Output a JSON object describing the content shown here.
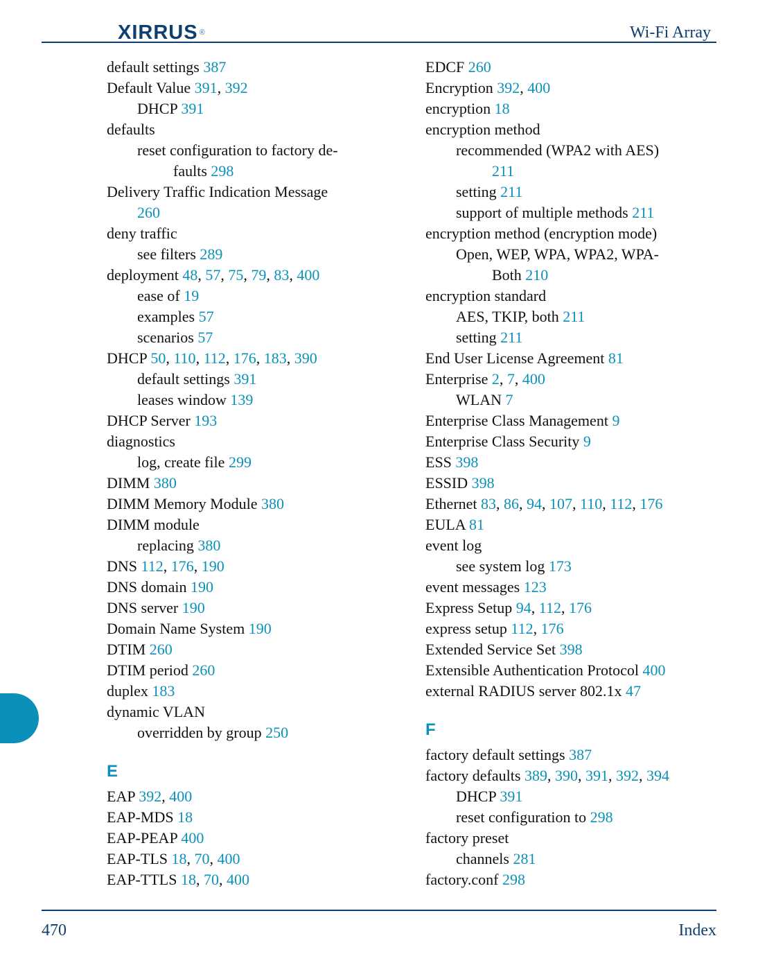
{
  "header": {
    "brand": "XIRRUS",
    "brand_reg": "®",
    "doc_title": "Wi-Fi Array"
  },
  "footer": {
    "page_number": "470",
    "label": "Index"
  },
  "columns": {
    "left": [
      {
        "type": "entry",
        "indent": 0,
        "parts": [
          {
            "t": "default settings "
          },
          {
            "p": "387"
          }
        ]
      },
      {
        "type": "entry",
        "indent": 0,
        "parts": [
          {
            "t": "Default Value "
          },
          {
            "p": "391"
          },
          {
            "t": ", "
          },
          {
            "p": "392"
          }
        ]
      },
      {
        "type": "entry",
        "indent": 1,
        "parts": [
          {
            "t": "DHCP "
          },
          {
            "p": "391"
          }
        ]
      },
      {
        "type": "entry",
        "indent": 0,
        "parts": [
          {
            "t": "defaults"
          }
        ]
      },
      {
        "type": "entry",
        "indent": 1,
        "justify": true,
        "parts": [
          {
            "t": "reset configuration to factory de-"
          }
        ]
      },
      {
        "type": "entry",
        "indent": 2,
        "parts": [
          {
            "t": "faults "
          },
          {
            "p": "298"
          }
        ]
      },
      {
        "type": "entry",
        "indent": 0,
        "justify": true,
        "parts": [
          {
            "t": "Delivery Traffic Indication Message"
          }
        ]
      },
      {
        "type": "entry",
        "indent": 1,
        "parts": [
          {
            "p": "260"
          }
        ]
      },
      {
        "type": "entry",
        "indent": 0,
        "parts": [
          {
            "t": "deny traffic"
          }
        ]
      },
      {
        "type": "entry",
        "indent": 1,
        "parts": [
          {
            "t": "see filters "
          },
          {
            "p": "289"
          }
        ]
      },
      {
        "type": "entry",
        "indent": 0,
        "parts": [
          {
            "t": "deployment "
          },
          {
            "p": "48"
          },
          {
            "t": ", "
          },
          {
            "p": "57"
          },
          {
            "t": ", "
          },
          {
            "p": "75"
          },
          {
            "t": ", "
          },
          {
            "p": "79"
          },
          {
            "t": ", "
          },
          {
            "p": "83"
          },
          {
            "t": ", "
          },
          {
            "p": "400"
          }
        ]
      },
      {
        "type": "entry",
        "indent": 1,
        "parts": [
          {
            "t": "ease of "
          },
          {
            "p": "19"
          }
        ]
      },
      {
        "type": "entry",
        "indent": 1,
        "parts": [
          {
            "t": "examples "
          },
          {
            "p": "57"
          }
        ]
      },
      {
        "type": "entry",
        "indent": 1,
        "parts": [
          {
            "t": "scenarios "
          },
          {
            "p": "57"
          }
        ]
      },
      {
        "type": "entry",
        "indent": 0,
        "parts": [
          {
            "t": "DHCP "
          },
          {
            "p": "50"
          },
          {
            "t": ", "
          },
          {
            "p": "110"
          },
          {
            "t": ", "
          },
          {
            "p": "112"
          },
          {
            "t": ", "
          },
          {
            "p": "176"
          },
          {
            "t": ", "
          },
          {
            "p": "183"
          },
          {
            "t": ", "
          },
          {
            "p": "390"
          }
        ]
      },
      {
        "type": "entry",
        "indent": 1,
        "parts": [
          {
            "t": "default settings "
          },
          {
            "p": "391"
          }
        ]
      },
      {
        "type": "entry",
        "indent": 1,
        "parts": [
          {
            "t": "leases window "
          },
          {
            "p": "139"
          }
        ]
      },
      {
        "type": "entry",
        "indent": 0,
        "parts": [
          {
            "t": "DHCP Server "
          },
          {
            "p": "193"
          }
        ]
      },
      {
        "type": "entry",
        "indent": 0,
        "parts": [
          {
            "t": "diagnostics"
          }
        ]
      },
      {
        "type": "entry",
        "indent": 1,
        "parts": [
          {
            "t": "log, create file "
          },
          {
            "p": "299"
          }
        ]
      },
      {
        "type": "entry",
        "indent": 0,
        "parts": [
          {
            "t": "DIMM "
          },
          {
            "p": "380"
          }
        ]
      },
      {
        "type": "entry",
        "indent": 0,
        "parts": [
          {
            "t": "DIMM Memory Module "
          },
          {
            "p": "380"
          }
        ]
      },
      {
        "type": "entry",
        "indent": 0,
        "parts": [
          {
            "t": "DIMM module"
          }
        ]
      },
      {
        "type": "entry",
        "indent": 1,
        "parts": [
          {
            "t": "replacing "
          },
          {
            "p": "380"
          }
        ]
      },
      {
        "type": "entry",
        "indent": 0,
        "parts": [
          {
            "t": "DNS "
          },
          {
            "p": "112"
          },
          {
            "t": ", "
          },
          {
            "p": "176"
          },
          {
            "t": ", "
          },
          {
            "p": "190"
          }
        ]
      },
      {
        "type": "entry",
        "indent": 0,
        "parts": [
          {
            "t": "DNS domain "
          },
          {
            "p": "190"
          }
        ]
      },
      {
        "type": "entry",
        "indent": 0,
        "parts": [
          {
            "t": "DNS server "
          },
          {
            "p": "190"
          }
        ]
      },
      {
        "type": "entry",
        "indent": 0,
        "parts": [
          {
            "t": "Domain Name System "
          },
          {
            "p": "190"
          }
        ]
      },
      {
        "type": "entry",
        "indent": 0,
        "parts": [
          {
            "t": "DTIM "
          },
          {
            "p": "260"
          }
        ]
      },
      {
        "type": "entry",
        "indent": 0,
        "parts": [
          {
            "t": "DTIM period "
          },
          {
            "p": "260"
          }
        ]
      },
      {
        "type": "entry",
        "indent": 0,
        "parts": [
          {
            "t": "duplex "
          },
          {
            "p": "183"
          }
        ]
      },
      {
        "type": "entry",
        "indent": 0,
        "parts": [
          {
            "t": "dynamic VLAN"
          }
        ]
      },
      {
        "type": "entry",
        "indent": 1,
        "parts": [
          {
            "t": "overridden by group "
          },
          {
            "p": "250"
          }
        ]
      },
      {
        "type": "section",
        "letter": "E"
      },
      {
        "type": "entry",
        "indent": 0,
        "parts": [
          {
            "t": "EAP "
          },
          {
            "p": "392"
          },
          {
            "t": ", "
          },
          {
            "p": "400"
          }
        ]
      },
      {
        "type": "entry",
        "indent": 0,
        "parts": [
          {
            "t": "EAP-MDS "
          },
          {
            "p": "18"
          }
        ]
      },
      {
        "type": "entry",
        "indent": 0,
        "parts": [
          {
            "t": "EAP-PEAP "
          },
          {
            "p": "400"
          }
        ]
      },
      {
        "type": "entry",
        "indent": 0,
        "parts": [
          {
            "t": "EAP-TLS "
          },
          {
            "p": "18"
          },
          {
            "t": ", "
          },
          {
            "p": "70"
          },
          {
            "t": ", "
          },
          {
            "p": "400"
          }
        ]
      },
      {
        "type": "entry",
        "indent": 0,
        "parts": [
          {
            "t": "EAP-TTLS "
          },
          {
            "p": "18"
          },
          {
            "t": ", "
          },
          {
            "p": "70"
          },
          {
            "t": ", "
          },
          {
            "p": "400"
          }
        ]
      }
    ],
    "right": [
      {
        "type": "entry",
        "indent": 0,
        "parts": [
          {
            "t": "EDCF "
          },
          {
            "p": "260"
          }
        ]
      },
      {
        "type": "entry",
        "indent": 0,
        "parts": [
          {
            "t": "Encryption "
          },
          {
            "p": "392"
          },
          {
            "t": ", "
          },
          {
            "p": "400"
          }
        ]
      },
      {
        "type": "entry",
        "indent": 0,
        "parts": [
          {
            "t": "encryption "
          },
          {
            "p": "18"
          }
        ]
      },
      {
        "type": "entry",
        "indent": 0,
        "parts": [
          {
            "t": "encryption method"
          }
        ]
      },
      {
        "type": "entry",
        "indent": 1,
        "justify": true,
        "parts": [
          {
            "t": "recommended (WPA2 with AES)"
          }
        ]
      },
      {
        "type": "entry",
        "indent": 2,
        "parts": [
          {
            "p": "211"
          }
        ]
      },
      {
        "type": "entry",
        "indent": 1,
        "parts": [
          {
            "t": "setting "
          },
          {
            "p": "211"
          }
        ]
      },
      {
        "type": "entry",
        "indent": 1,
        "parts": [
          {
            "t": "support of multiple methods "
          },
          {
            "p": "211"
          }
        ]
      },
      {
        "type": "entry",
        "indent": 0,
        "parts": [
          {
            "t": "encryption method (encryption mode)"
          }
        ]
      },
      {
        "type": "entry",
        "indent": 1,
        "justify": true,
        "parts": [
          {
            "t": "Open, WEP, WPA, WPA2, WPA-"
          }
        ]
      },
      {
        "type": "entry",
        "indent": 2,
        "parts": [
          {
            "t": "Both "
          },
          {
            "p": "210"
          }
        ]
      },
      {
        "type": "entry",
        "indent": 0,
        "parts": [
          {
            "t": "encryption standard"
          }
        ]
      },
      {
        "type": "entry",
        "indent": 1,
        "parts": [
          {
            "t": "AES, TKIP, both "
          },
          {
            "p": "211"
          }
        ]
      },
      {
        "type": "entry",
        "indent": 1,
        "parts": [
          {
            "t": "setting "
          },
          {
            "p": "211"
          }
        ]
      },
      {
        "type": "entry",
        "indent": 0,
        "parts": [
          {
            "t": "End User License Agreement "
          },
          {
            "p": "81"
          }
        ]
      },
      {
        "type": "entry",
        "indent": 0,
        "parts": [
          {
            "t": "Enterprise "
          },
          {
            "p": "2"
          },
          {
            "t": ", "
          },
          {
            "p": "7"
          },
          {
            "t": ", "
          },
          {
            "p": "400"
          }
        ]
      },
      {
        "type": "entry",
        "indent": 1,
        "parts": [
          {
            "t": "WLAN "
          },
          {
            "p": "7"
          }
        ]
      },
      {
        "type": "entry",
        "indent": 0,
        "parts": [
          {
            "t": "Enterprise Class Management "
          },
          {
            "p": "9"
          }
        ]
      },
      {
        "type": "entry",
        "indent": 0,
        "parts": [
          {
            "t": "Enterprise Class Security "
          },
          {
            "p": "9"
          }
        ]
      },
      {
        "type": "entry",
        "indent": 0,
        "parts": [
          {
            "t": "ESS "
          },
          {
            "p": "398"
          }
        ]
      },
      {
        "type": "entry",
        "indent": 0,
        "parts": [
          {
            "t": "ESSID "
          },
          {
            "p": "398"
          }
        ]
      },
      {
        "type": "entry",
        "indent": 0,
        "parts": [
          {
            "t": "Ethernet "
          },
          {
            "p": "83"
          },
          {
            "t": ", "
          },
          {
            "p": "86"
          },
          {
            "t": ", "
          },
          {
            "p": "94"
          },
          {
            "t": ", "
          },
          {
            "p": "107"
          },
          {
            "t": ", "
          },
          {
            "p": "110"
          },
          {
            "t": ", "
          },
          {
            "p": "112"
          },
          {
            "t": ", "
          },
          {
            "p": "176"
          }
        ]
      },
      {
        "type": "entry",
        "indent": 0,
        "parts": [
          {
            "t": "EULA "
          },
          {
            "p": "81"
          }
        ]
      },
      {
        "type": "entry",
        "indent": 0,
        "parts": [
          {
            "t": "event log"
          }
        ]
      },
      {
        "type": "entry",
        "indent": 1,
        "parts": [
          {
            "t": "see system log "
          },
          {
            "p": "173"
          }
        ]
      },
      {
        "type": "entry",
        "indent": 0,
        "parts": [
          {
            "t": "event messages "
          },
          {
            "p": "123"
          }
        ]
      },
      {
        "type": "entry",
        "indent": 0,
        "parts": [
          {
            "t": "Express Setup "
          },
          {
            "p": "94"
          },
          {
            "t": ", "
          },
          {
            "p": "112"
          },
          {
            "t": ", "
          },
          {
            "p": "176"
          }
        ]
      },
      {
        "type": "entry",
        "indent": 0,
        "parts": [
          {
            "t": "express setup "
          },
          {
            "p": "112"
          },
          {
            "t": ", "
          },
          {
            "p": "176"
          }
        ]
      },
      {
        "type": "entry",
        "indent": 0,
        "parts": [
          {
            "t": "Extended Service Set "
          },
          {
            "p": "398"
          }
        ]
      },
      {
        "type": "entry",
        "indent": 0,
        "parts": [
          {
            "t": "Extensible Authentication Protocol "
          },
          {
            "p": "400"
          }
        ]
      },
      {
        "type": "entry",
        "indent": 0,
        "parts": [
          {
            "t": "external RADIUS server 802.1x "
          },
          {
            "p": "47"
          }
        ]
      },
      {
        "type": "section",
        "letter": "F"
      },
      {
        "type": "entry",
        "indent": 0,
        "parts": [
          {
            "t": "factory default settings "
          },
          {
            "p": "387"
          }
        ]
      },
      {
        "type": "entry",
        "indent": 0,
        "parts": [
          {
            "t": "factory defaults "
          },
          {
            "p": "389"
          },
          {
            "t": ", "
          },
          {
            "p": "390"
          },
          {
            "t": ", "
          },
          {
            "p": "391"
          },
          {
            "t": ", "
          },
          {
            "p": "392"
          },
          {
            "t": ", "
          },
          {
            "p": "394"
          }
        ]
      },
      {
        "type": "entry",
        "indent": 1,
        "parts": [
          {
            "t": "DHCP "
          },
          {
            "p": "391"
          }
        ]
      },
      {
        "type": "entry",
        "indent": 1,
        "parts": [
          {
            "t": "reset configuration to "
          },
          {
            "p": "298"
          }
        ]
      },
      {
        "type": "entry",
        "indent": 0,
        "parts": [
          {
            "t": "factory preset"
          }
        ]
      },
      {
        "type": "entry",
        "indent": 1,
        "parts": [
          {
            "t": "channels "
          },
          {
            "p": "281"
          }
        ]
      },
      {
        "type": "entry",
        "indent": 0,
        "parts": [
          {
            "t": "factory.conf "
          },
          {
            "p": "298"
          }
        ]
      }
    ]
  }
}
